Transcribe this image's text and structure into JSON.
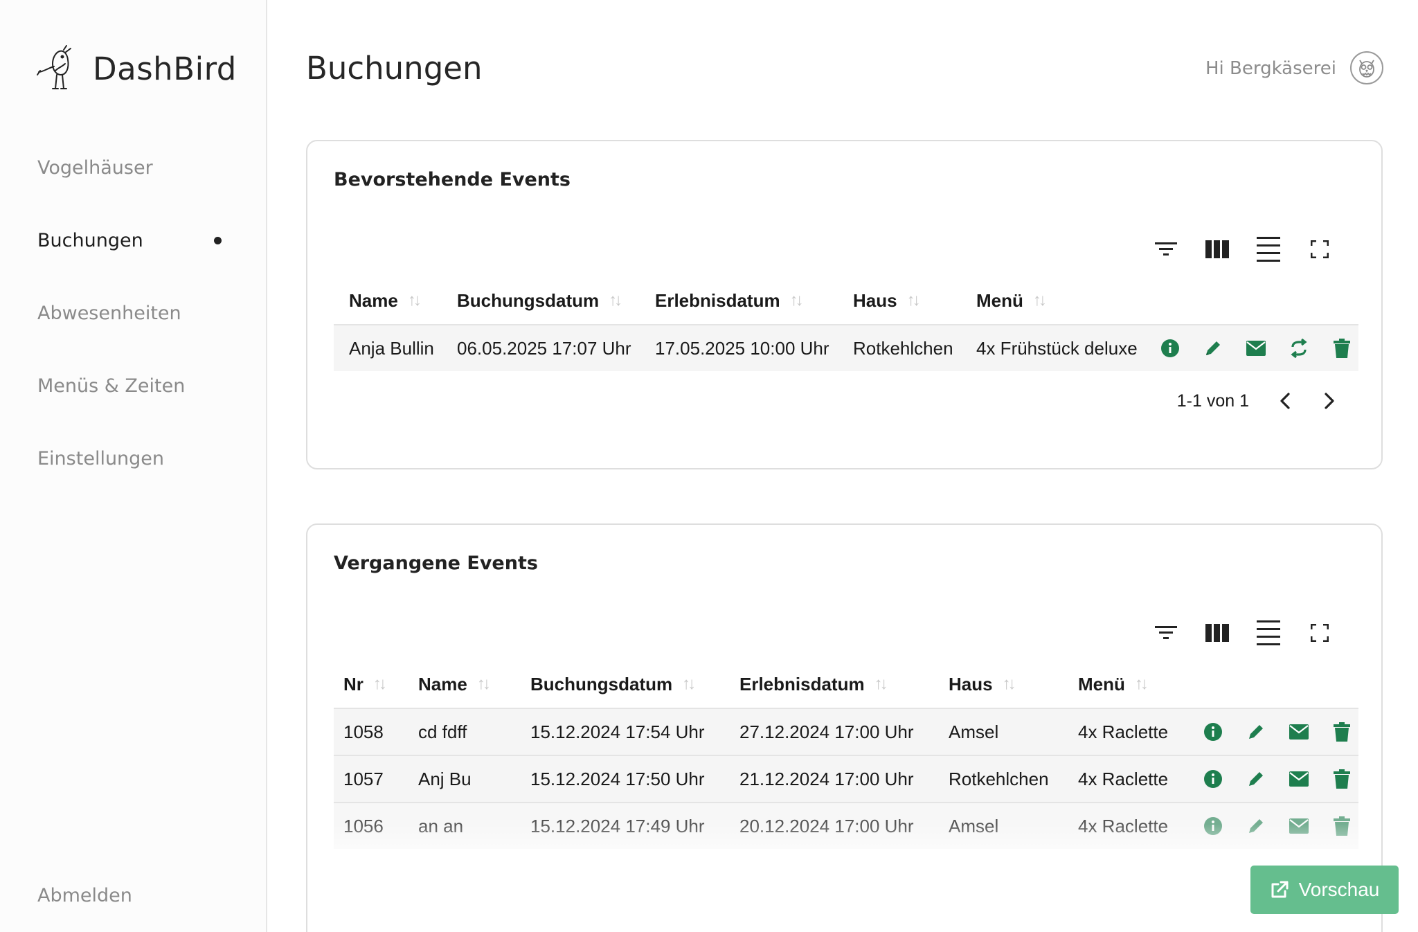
{
  "app": {
    "name": "DashBird"
  },
  "sidebar": {
    "items": [
      {
        "label": "Vogelhäuser",
        "active": false
      },
      {
        "label": "Buchungen",
        "active": true
      },
      {
        "label": "Abwesenheiten",
        "active": false
      },
      {
        "label": "Menüs & Zeiten",
        "active": false
      },
      {
        "label": "Einstellungen",
        "active": false
      }
    ],
    "logout_label": "Abmelden"
  },
  "header": {
    "title": "Buchungen",
    "greeting": "Hi Bergkäserei"
  },
  "upcoming": {
    "title": "Bevorstehende Events",
    "columns": [
      "Name",
      "Buchungsdatum",
      "Erlebnisdatum",
      "Haus",
      "Menü"
    ],
    "rows": [
      {
        "name": "Anja Bullin",
        "booking_date": "06.05.2025 17:07 Uhr",
        "event_date": "17.05.2025 10:00 Uhr",
        "house": "Rotkehlchen",
        "menu": "4x Frühstück deluxe"
      }
    ],
    "pagination": "1-1 von 1"
  },
  "past": {
    "title": "Vergangene Events",
    "columns": [
      "Nr",
      "Name",
      "Buchungsdatum",
      "Erlebnisdatum",
      "Haus",
      "Menü"
    ],
    "rows": [
      {
        "nr": "1058",
        "name": "cd fdff",
        "booking_date": "15.12.2024 17:54 Uhr",
        "event_date": "27.12.2024 17:00 Uhr",
        "house": "Amsel",
        "menu": "4x Raclette"
      },
      {
        "nr": "1057",
        "name": "Anj Bu",
        "booking_date": "15.12.2024 17:50 Uhr",
        "event_date": "21.12.2024 17:00 Uhr",
        "house": "Rotkehlchen",
        "menu": "4x Raclette"
      },
      {
        "nr": "1056",
        "name": "an an",
        "booking_date": "15.12.2024 17:49 Uhr",
        "event_date": "20.12.2024 17:00 Uhr",
        "house": "Amsel",
        "menu": "4x Raclette"
      }
    ]
  },
  "preview_button": {
    "label": "Vorschau"
  },
  "colors": {
    "accent": "#1e7e4e",
    "preview_bg": "#65be8e",
    "row_bg": "#f5f5f5"
  },
  "icons": [
    "bird-logo-icon",
    "owl-avatar-icon",
    "filter-icon",
    "columns-icon",
    "density-icon",
    "fullscreen-icon",
    "info-icon",
    "edit-icon",
    "mail-icon",
    "rebook-icon",
    "trash-icon",
    "chevron-left-icon",
    "chevron-right-icon",
    "external-link-icon"
  ]
}
